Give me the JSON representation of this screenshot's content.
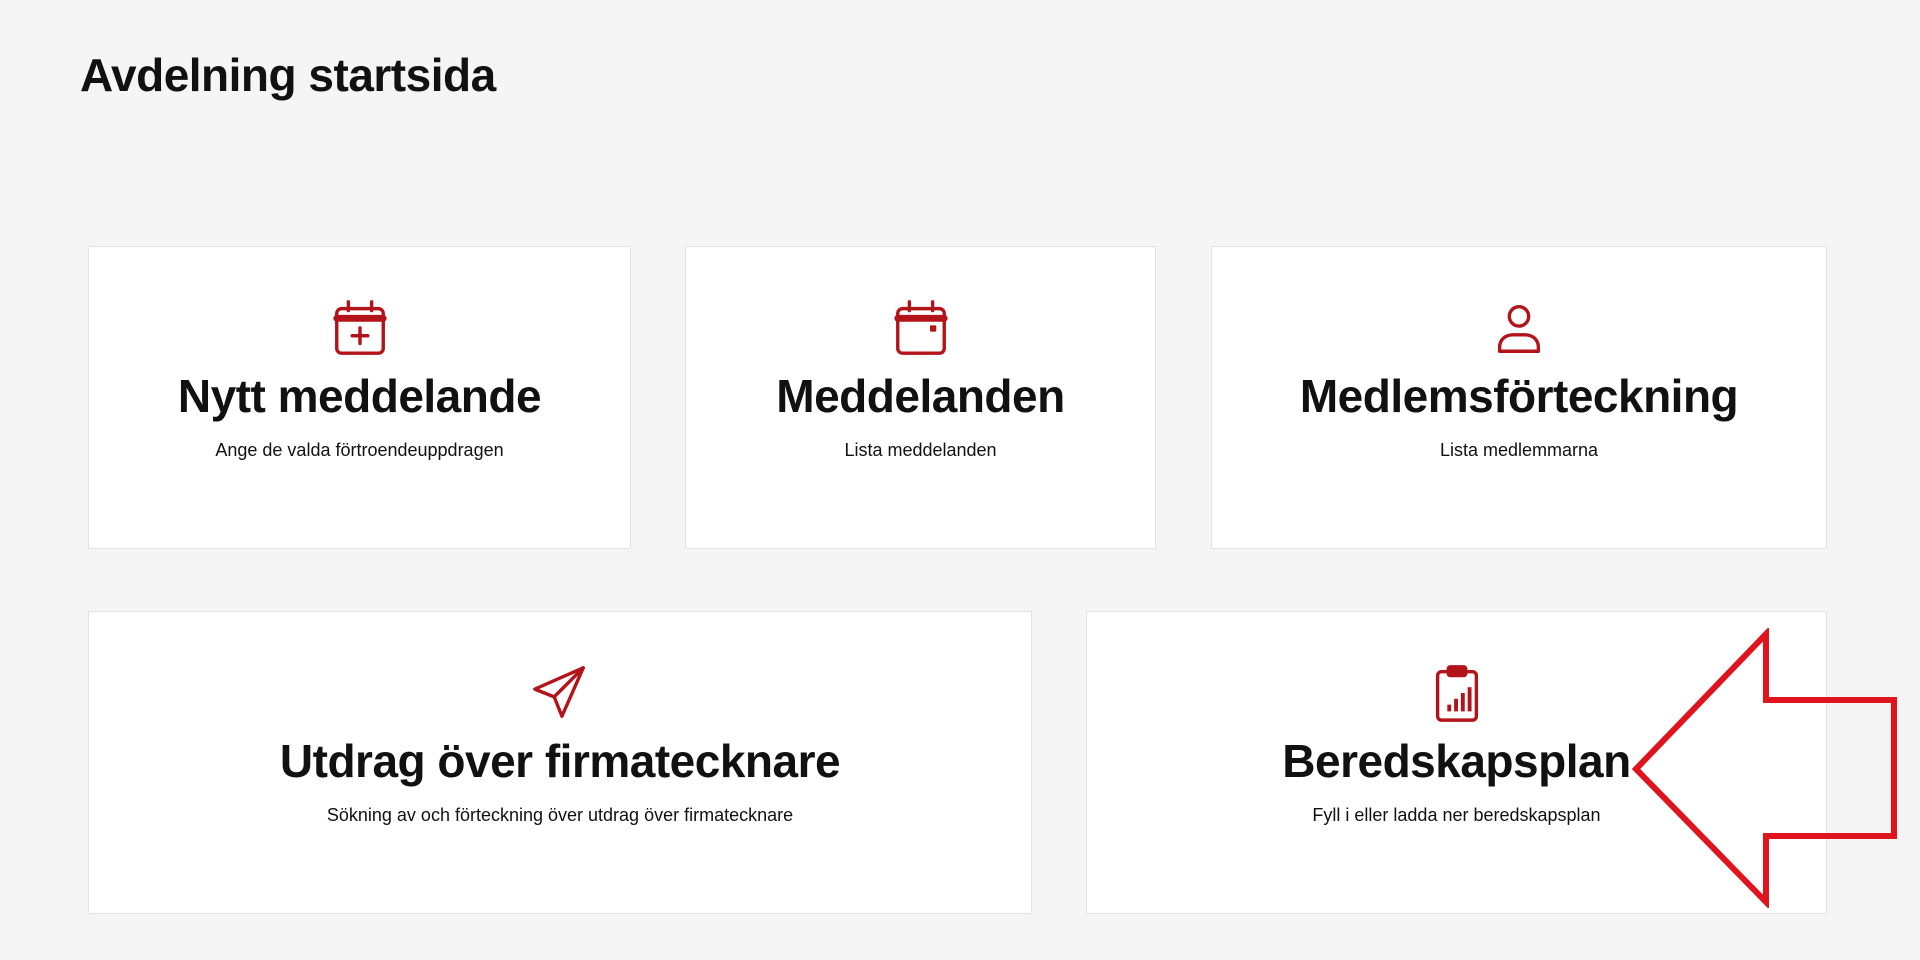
{
  "page": {
    "title": "Avdelning startsida"
  },
  "theme": {
    "accent": "#b3141a",
    "background": "#f5f5f5",
    "card_background": "#ffffff",
    "annotation_color": "#e0141e"
  },
  "cards": [
    {
      "title": "Nytt meddelande",
      "description": "Ange de valda förtroendeuppdragen",
      "icon": "calendar-plus-icon"
    },
    {
      "title": "Meddelanden",
      "description": "Lista meddelanden",
      "icon": "calendar-icon"
    },
    {
      "title": "Medlemsförteckning",
      "description": "Lista medlemmarna",
      "icon": "user-icon"
    },
    {
      "title": "Utdrag över firmatecknare",
      "description": "Sökning av och förteckning över utdrag över firmatecknare",
      "icon": "paper-plane-icon"
    },
    {
      "title": "Beredskapsplan",
      "description": "Fyll i eller ladda ner beredskapsplan",
      "icon": "clipboard-chart-icon"
    }
  ],
  "annotation": {
    "icon": "left-arrow-outline-icon"
  }
}
